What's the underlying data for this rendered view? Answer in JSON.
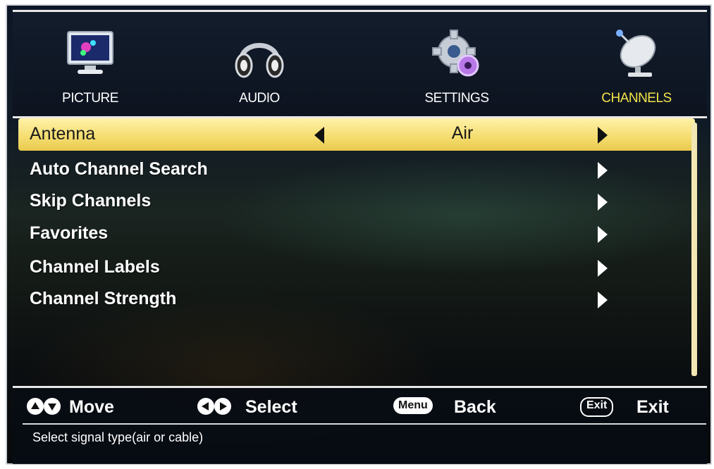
{
  "tabs": [
    {
      "label": "PICTURE",
      "icon": "monitor-icon",
      "active": false
    },
    {
      "label": "AUDIO",
      "icon": "headphones-icon",
      "active": false
    },
    {
      "label": "SETTINGS",
      "icon": "gear-icon",
      "active": false
    },
    {
      "label": "CHANNELS",
      "icon": "satellite-dish-icon",
      "active": true
    }
  ],
  "menu": {
    "items": [
      {
        "label": "Antenna",
        "value": "Air",
        "selected": true
      },
      {
        "label": "Auto Channel Search"
      },
      {
        "label": "Skip Channels"
      },
      {
        "label": "Favorites"
      },
      {
        "label": "Channel Labels"
      },
      {
        "label": "Channel Strength"
      }
    ]
  },
  "help": {
    "move": "Move",
    "select": "Select",
    "menu_key": "Menu",
    "back": "Back",
    "exit_key": "Exit",
    "exit": "Exit",
    "description": "Select signal type(air or cable)"
  },
  "colors": {
    "active_tab": "#f2e24a",
    "highlight": "#f4dc6e",
    "text": "#ffffff"
  }
}
